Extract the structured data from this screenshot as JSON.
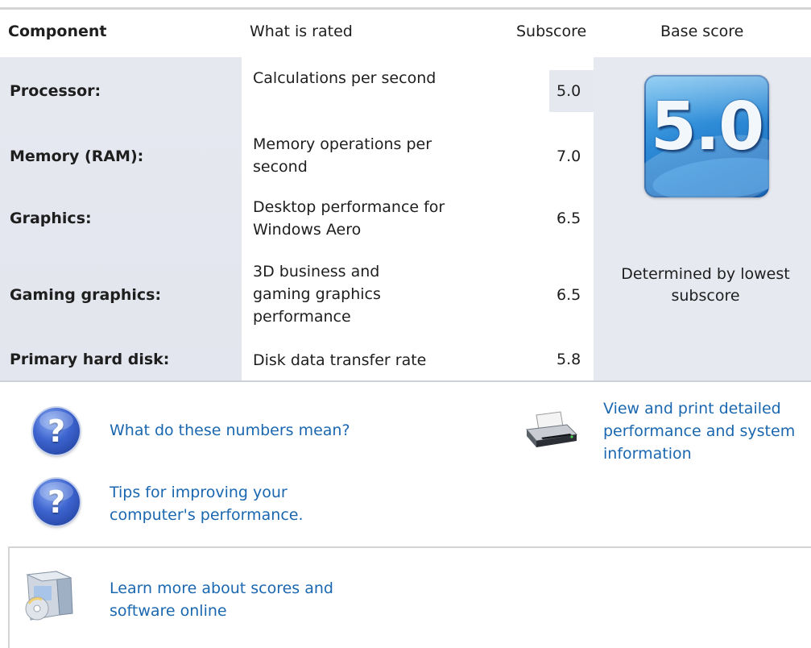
{
  "header": {
    "component": "Component",
    "what_is_rated": "What is rated",
    "subscore": "Subscore",
    "base_score": "Base score"
  },
  "rows": [
    {
      "component": "Processor:",
      "rated": "Calculations per second",
      "subscore": "5.0"
    },
    {
      "component": "Memory (RAM):",
      "rated": "Memory operations per second",
      "subscore": "7.0"
    },
    {
      "component": "Graphics:",
      "rated": "Desktop performance for Windows Aero",
      "subscore": "6.5"
    },
    {
      "component": "Gaming graphics:",
      "rated": "3D business and gaming graphics performance",
      "subscore": "6.5"
    },
    {
      "component": "Primary hard disk:",
      "rated": "Disk data transfer rate",
      "subscore": "5.8"
    }
  ],
  "base": {
    "score": "5.0",
    "caption": "Determined by lowest subscore"
  },
  "links": {
    "numbers_mean": "What do these numbers mean?",
    "tips": "Tips for improving your computer's performance.",
    "view_print": "View and print detailed performance and system information",
    "learn_more": "Learn more about scores and software online"
  },
  "icons": {
    "help": "help-icon",
    "printer": "printer-icon",
    "online": "software-box-icon"
  },
  "colors": {
    "link": "#1a67b0",
    "panel": "#e6e8f0",
    "tile": "#2c8ad6"
  }
}
